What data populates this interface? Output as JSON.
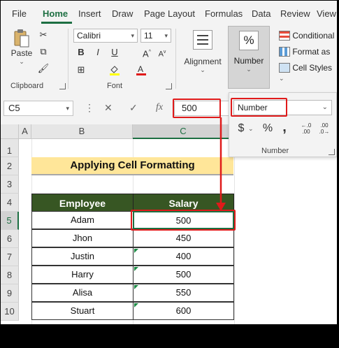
{
  "menu": [
    "File",
    "Home",
    "Insert",
    "Draw",
    "Page Layout",
    "Formulas",
    "Data",
    "Review",
    "View"
  ],
  "ribbon": {
    "clipboard": {
      "paste": "Paste",
      "label": "Clipboard"
    },
    "font": {
      "name": "Calibri",
      "size": "11",
      "bold": "B",
      "italic": "I",
      "underline": "U",
      "label": "Font"
    },
    "alignment": {
      "label": "Alignment"
    },
    "number": {
      "label": "Number",
      "icon": "%"
    },
    "styles": {
      "conditional": "Conditional",
      "format_as": "Format as",
      "cell_styles": "Cell Styles"
    }
  },
  "formula_bar": {
    "name_box": "C5",
    "fx": "fx",
    "value": "500"
  },
  "number_popup": {
    "format": "Number",
    "currency": "$",
    "percent": "%",
    "comma": ",",
    "dec_inc": ".00",
    "dec_dec": ".0",
    "label": "Number"
  },
  "columns": [
    "A",
    "B",
    "C"
  ],
  "rows": [
    "1",
    "2",
    "3",
    "4",
    "5",
    "6",
    "7",
    "8",
    "9",
    "10"
  ],
  "sheet": {
    "title": "Applying Cell Formatting",
    "headers": [
      "Employee",
      "Salary"
    ],
    "data": [
      {
        "employee": "Adam",
        "salary": "500"
      },
      {
        "employee": "Jhon",
        "salary": "450"
      },
      {
        "employee": "Justin",
        "salary": "400"
      },
      {
        "employee": "Harry",
        "salary": "500"
      },
      {
        "employee": "Alisa",
        "salary": "550"
      },
      {
        "employee": "Stuart",
        "salary": "600"
      }
    ]
  },
  "colors": {
    "accent": "#1d6f42",
    "header_fill": "#375623",
    "title_fill": "#ffe699",
    "highlight": "#e01a1a"
  }
}
